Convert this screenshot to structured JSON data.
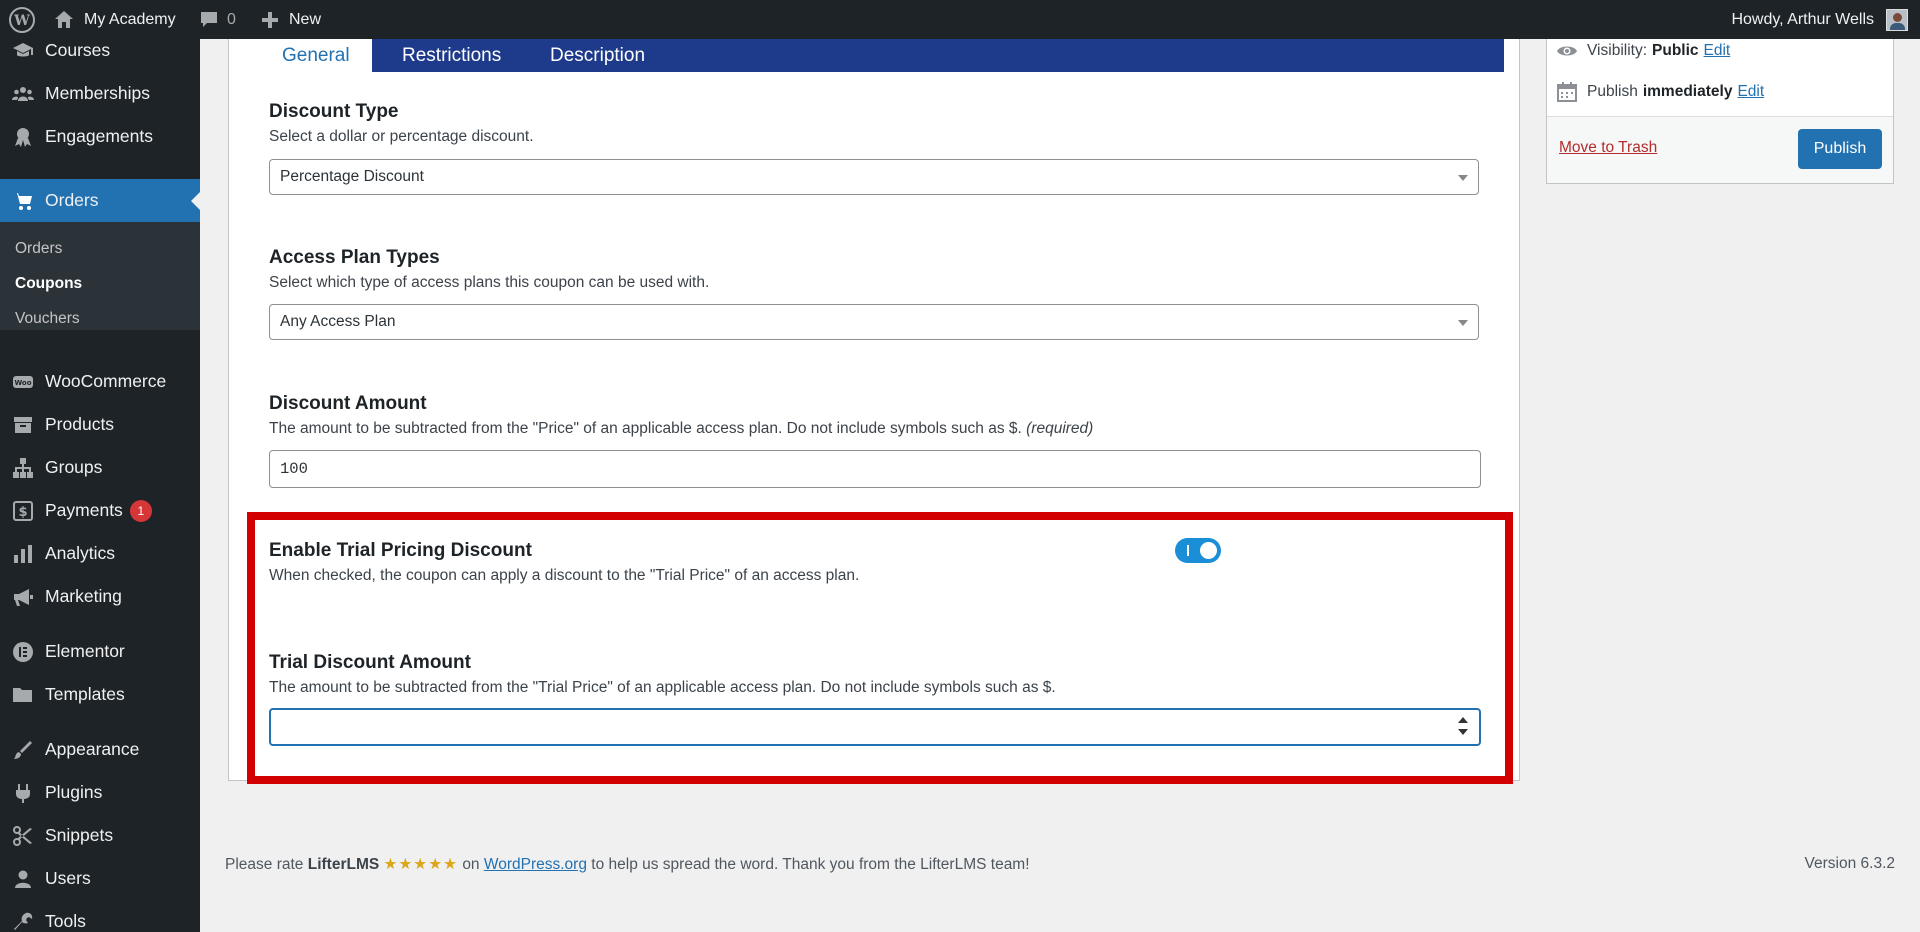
{
  "admin_bar": {
    "site_name": "My Academy",
    "comments_count": "0",
    "new_label": "New",
    "greeting": "Howdy, Arthur Wells"
  },
  "sidebar": {
    "items": [
      {
        "label": "Courses",
        "icon": "graduation-cap-icon"
      },
      {
        "label": "Memberships",
        "icon": "groups-icon"
      },
      {
        "label": "Engagements",
        "icon": "award-icon"
      },
      {
        "label": "Orders",
        "icon": "cart-icon"
      },
      {
        "label": "WooCommerce",
        "icon": "woo-icon"
      },
      {
        "label": "Products",
        "icon": "archive-icon"
      },
      {
        "label": "Groups",
        "icon": "hierarchy-icon"
      },
      {
        "label": "Payments",
        "icon": "dollar-icon",
        "badge": "1"
      },
      {
        "label": "Analytics",
        "icon": "bar-chart-icon"
      },
      {
        "label": "Marketing",
        "icon": "megaphone-icon"
      },
      {
        "label": "Elementor",
        "icon": "elementor-icon"
      },
      {
        "label": "Templates",
        "icon": "folder-icon"
      },
      {
        "label": "Appearance",
        "icon": "paintbrush-icon"
      },
      {
        "label": "Plugins",
        "icon": "plug-icon"
      },
      {
        "label": "Snippets",
        "icon": "scissors-icon"
      },
      {
        "label": "Users",
        "icon": "user-icon"
      },
      {
        "label": "Tools",
        "icon": "wrench-icon"
      }
    ],
    "submenu": [
      "Orders",
      "Coupons",
      "Vouchers"
    ]
  },
  "tabs": [
    "General",
    "Restrictions",
    "Description"
  ],
  "fields": {
    "discount_type": {
      "title": "Discount Type",
      "desc": "Select a dollar or percentage discount.",
      "value": "Percentage Discount"
    },
    "access_plan_types": {
      "title": "Access Plan Types",
      "desc": "Select which type of access plans this coupon can be used with.",
      "value": "Any Access Plan"
    },
    "discount_amount": {
      "title": "Discount Amount",
      "desc": "The amount to be subtracted from the \"Price\" of an applicable access plan. Do not include symbols such as $.",
      "required": "(required)",
      "value": "100"
    },
    "enable_trial": {
      "title": "Enable Trial Pricing Discount",
      "desc": "When checked, the coupon can apply a discount to the \"Trial Price\" of an access plan.",
      "checked": true
    },
    "trial_amount": {
      "title": "Trial Discount Amount",
      "desc": "The amount to be subtracted from the \"Trial Price\" of an applicable access plan. Do not include symbols such as $.",
      "value": ""
    }
  },
  "publish": {
    "visibility_label": "Visibility:",
    "visibility_value": "Public",
    "publish_label": "Publish",
    "publish_value": "immediately",
    "edit_label": "Edit",
    "trash_label": "Move to Trash",
    "button_label": "Publish"
  },
  "footer": {
    "rate_prefix": "Please rate",
    "plugin_name": "LifterLMS",
    "stars": "★★★★★",
    "on": "on",
    "link_text": "WordPress.org",
    "suffix": "to help us spread the word. Thank you from the LifterLMS team!",
    "version": "Version 6.3.2"
  },
  "colors": {
    "highlight": "#d20000",
    "primary": "#2271b1",
    "tab_bar": "#1e3a8a"
  }
}
